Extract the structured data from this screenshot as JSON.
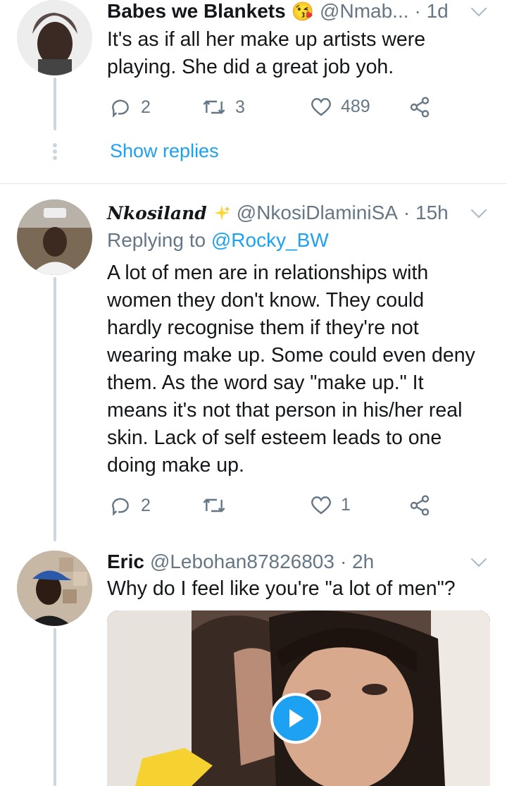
{
  "tweets": [
    {
      "name": "Babes we Blankets",
      "emoji": "😘",
      "handle": "@Nmab...",
      "time": "· 1d",
      "text": [
        "It's as if all her make up artists were",
        "playing. She did a great job yoh."
      ],
      "replies": "2",
      "retweets": "3",
      "likes": "489",
      "show_replies": "Show replies"
    },
    {
      "name": "Nkosiland",
      "handle": "@NkosiDlaminiSA",
      "time": "· 15h",
      "replying_prefix": "Replying to",
      "replying_to": "@Rocky_BW",
      "text": [
        "A lot of men are in relationships with",
        "women they don't know. They could",
        "hardly recognise them if they're not",
        "wearing make up. Some could even deny",
        "them. As the word say \"make up.\" It",
        "means it's not that person in his/her real",
        "skin. Lack of self esteem leads to one",
        "doing make up."
      ],
      "replies": "2",
      "retweets": "",
      "likes": "1"
    },
    {
      "name": "Eric",
      "handle": "@Lebohan87826803",
      "time": "· 2h",
      "text": [
        "Why do I feel like you're \"a lot of men\"?"
      ]
    }
  ],
  "colors": {
    "accent": "#1da1f2",
    "secondary_text": "#657786",
    "thread_line": "#ccd6dd"
  },
  "icons": [
    "reply-icon",
    "retweet-icon",
    "like-icon",
    "share-icon",
    "chevron-down-icon",
    "sparkle-icon",
    "play-icon"
  ]
}
